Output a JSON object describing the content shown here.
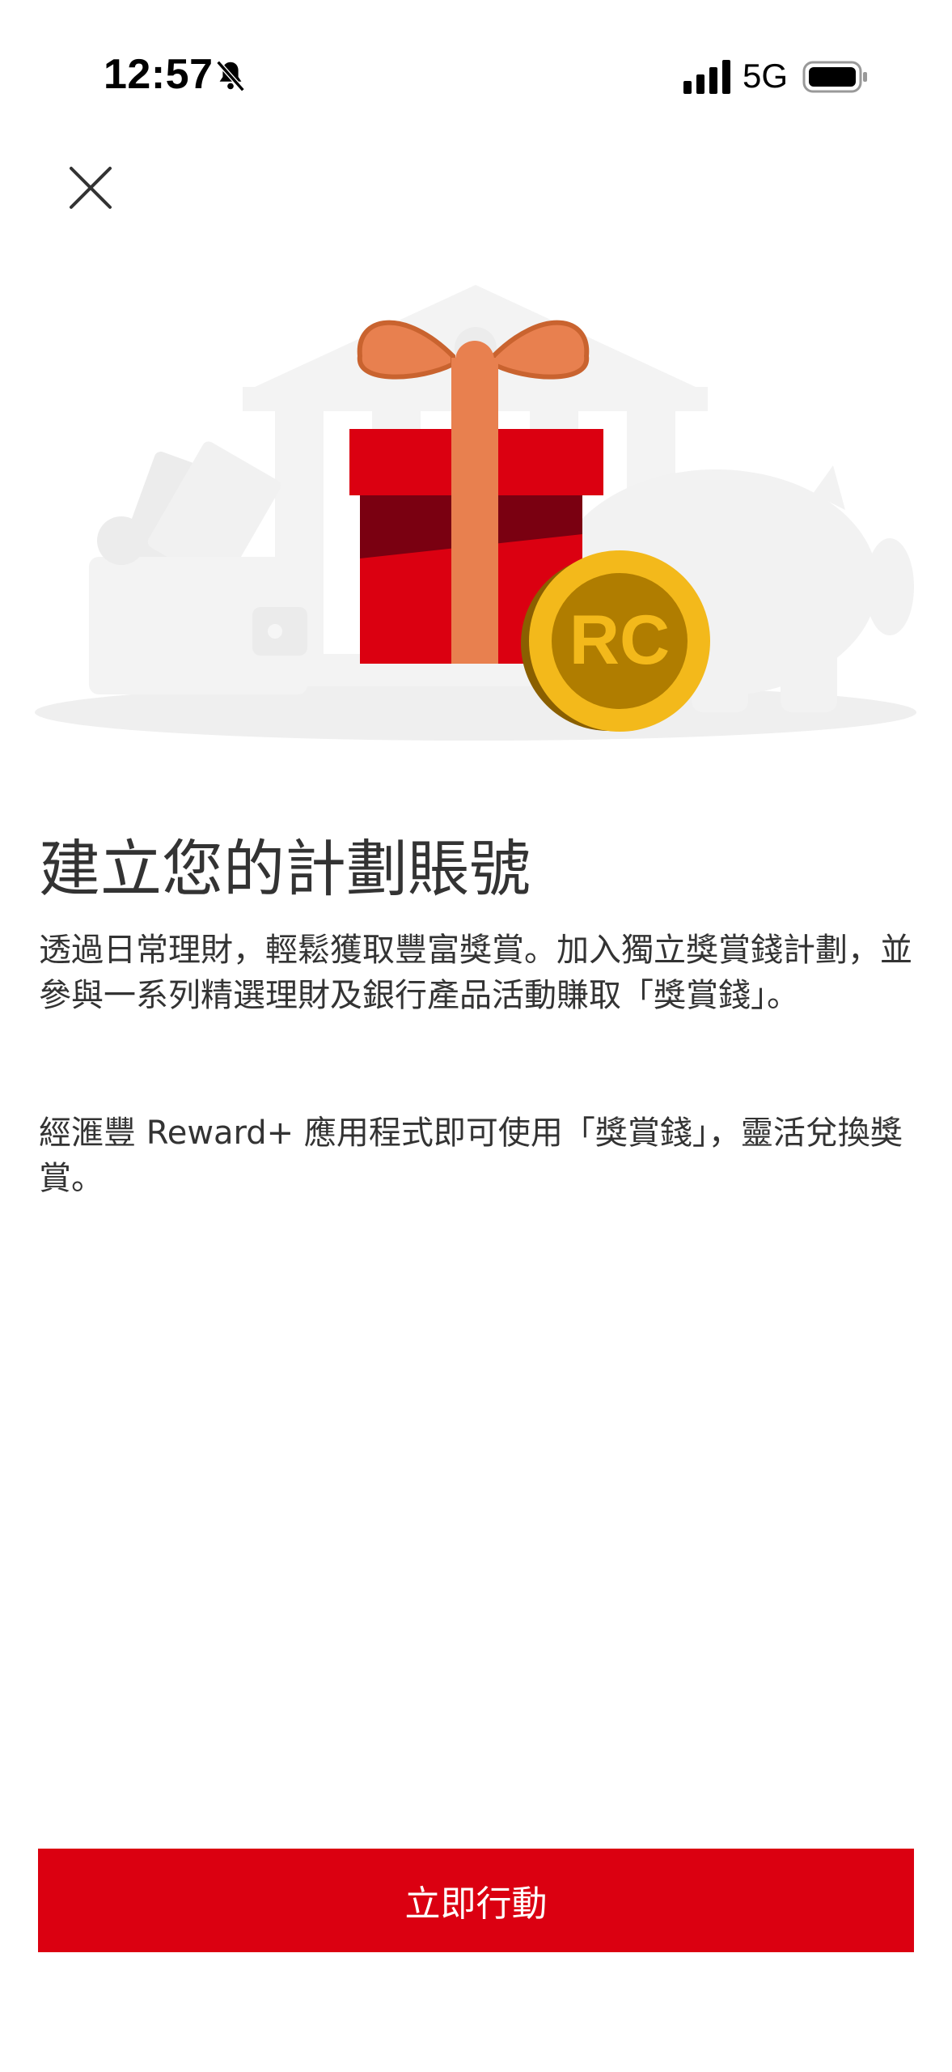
{
  "status_bar": {
    "time": "12:57",
    "network": "5G",
    "icons": [
      "bell-slash-icon",
      "cellular-signal-icon",
      "battery-icon"
    ]
  },
  "header": {
    "close_icon": "close-icon"
  },
  "hero": {
    "coin_label": "RC",
    "colors": {
      "gift_red": "#db0011",
      "ribbon": "#e8804f",
      "coin": "#f3b91b",
      "coin_inner": "#b07d00"
    }
  },
  "content": {
    "title": "建立您的計劃賬號",
    "description_1": "透過日常理財，輕鬆獲取豐富獎賞。加入獨立獎賞錢計劃，並參與一系列精選理財及銀行產品活動賺取「獎賞錢」。",
    "description_2": "經滙豐 Reward+ 應用程式即可使用「獎賞錢」，靈活兌換獎賞。"
  },
  "cta": {
    "label": "立即行動",
    "color": "#db0011"
  }
}
